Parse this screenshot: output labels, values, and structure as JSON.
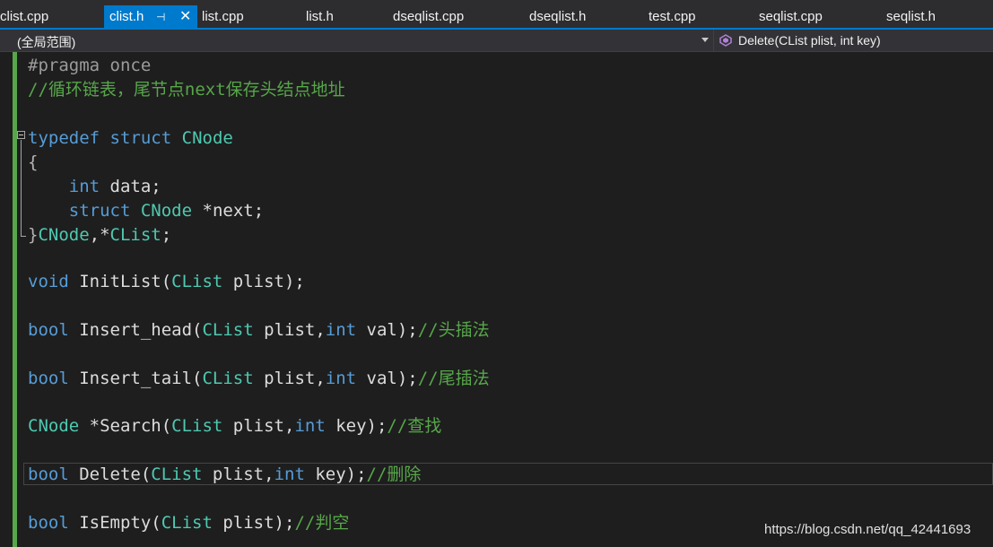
{
  "tabs": [
    {
      "label": "clist.cpp",
      "active": false
    },
    {
      "label": "clist.h",
      "active": true
    },
    {
      "label": "list.cpp",
      "active": false
    },
    {
      "label": "list.h",
      "active": false
    },
    {
      "label": "dseqlist.cpp",
      "active": false
    },
    {
      "label": "dseqlist.h",
      "active": false
    },
    {
      "label": "test.cpp",
      "active": false
    },
    {
      "label": "seqlist.cpp",
      "active": false
    },
    {
      "label": "seqlist.h",
      "active": false
    }
  ],
  "active_tab_pin": "⊣",
  "active_tab_close": "✕",
  "navbar": {
    "scope": "(全局范围)",
    "member": "Delete(CList plist, int key)"
  },
  "code": {
    "l1": {
      "a": "#pragma once"
    },
    "l2": {
      "a": "//循环链表，尾节点next保存头结点地址"
    },
    "l4": {
      "a": "typedef",
      "b": " ",
      "c": "struct",
      "d": " ",
      "e": "CNode"
    },
    "l5": {
      "a": "{"
    },
    "l6": {
      "a": "    ",
      "b": "int",
      "c": " data;"
    },
    "l7": {
      "a": "    ",
      "b": "struct",
      "c": " ",
      "d": "CNode",
      "e": " *next;"
    },
    "l8": {
      "a": "}",
      "b": "CNode",
      "c": ",*",
      "d": "CList",
      "e": ";"
    },
    "l10": {
      "a": "void",
      "b": " InitList(",
      "c": "CList",
      "d": " plist);"
    },
    "l12": {
      "a": "bool",
      "b": " Insert_head(",
      "c": "CList",
      "d": " plist,",
      "e": "int",
      "f": " val);",
      "g": "//头插法"
    },
    "l14": {
      "a": "bool",
      "b": " Insert_tail(",
      "c": "CList",
      "d": " plist,",
      "e": "int",
      "f": " val);",
      "g": "//尾插法"
    },
    "l16": {
      "a": "CNode",
      "b": " *Search(",
      "c": "CList",
      "d": " plist,",
      "e": "int",
      "f": " key);",
      "g": "//查找"
    },
    "l18": {
      "a": "bool",
      "b": " Delete(",
      "c": "CList",
      "d": " plist,",
      "e": "int",
      "f": " key);",
      "g": "//删除"
    },
    "l20": {
      "a": "bool",
      "b": " IsEmpty(",
      "c": "CList",
      "d": " plist);",
      "e": "//判空"
    }
  },
  "watermark": "https://blog.csdn.net/qq_42441693",
  "colors": {
    "accent": "#007acc",
    "keyword": "#569cd6",
    "type": "#4ec9b0",
    "comment": "#57a64a",
    "background": "#1e1e1e"
  }
}
